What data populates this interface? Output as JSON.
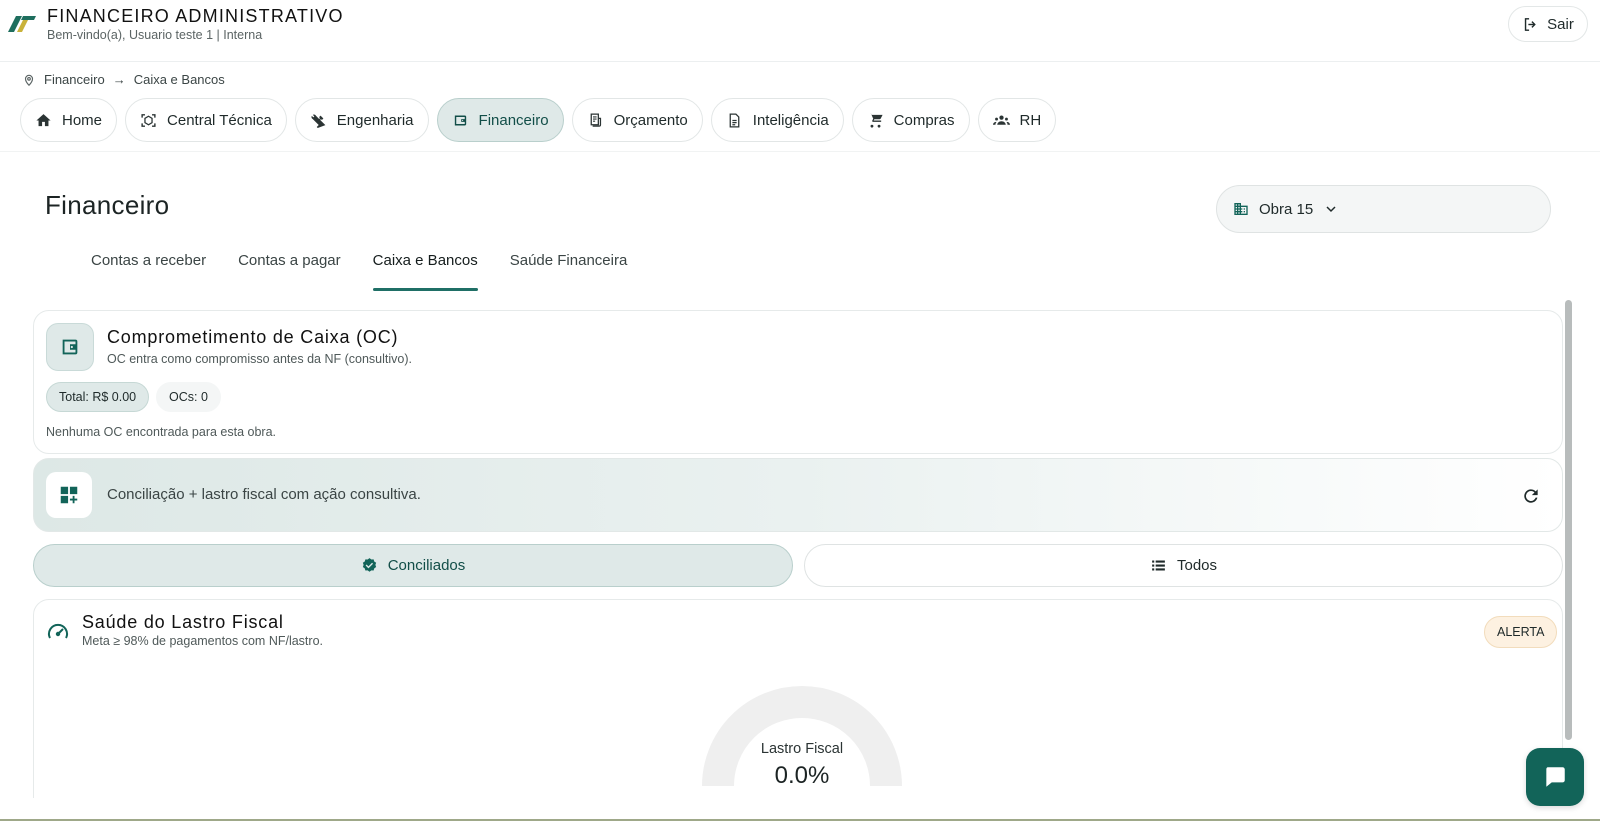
{
  "header": {
    "app_title": "FINANCEIRO ADMINISTRATIVO",
    "welcome": "Bem-vindo(a), Usuario teste 1 | Interna",
    "logout_label": "Sair"
  },
  "breadcrumb": {
    "items": [
      "Financeiro",
      "Caixa e Bancos"
    ],
    "separator": "→"
  },
  "modules": [
    {
      "label": "Home",
      "icon": "home-icon",
      "active": false
    },
    {
      "label": "Central Técnica",
      "icon": "scan-icon",
      "active": false
    },
    {
      "label": "Engenharia",
      "icon": "tools-icon",
      "active": false
    },
    {
      "label": "Financeiro",
      "icon": "wallet-icon",
      "active": true
    },
    {
      "label": "Orçamento",
      "icon": "receipt-icon",
      "active": false
    },
    {
      "label": "Inteligência",
      "icon": "document-icon",
      "active": false
    },
    {
      "label": "Compras",
      "icon": "cart-icon",
      "active": false
    },
    {
      "label": "RH",
      "icon": "people-icon",
      "active": false
    }
  ],
  "page": {
    "title": "Financeiro",
    "obra_selected": "Obra 15"
  },
  "subtabs": [
    {
      "label": "Contas a receber",
      "active": false
    },
    {
      "label": "Contas a pagar",
      "active": false
    },
    {
      "label": "Caixa e Bancos",
      "active": true
    },
    {
      "label": "Saúde Financeira",
      "active": false
    }
  ],
  "oc_card": {
    "title": "Comprometimento de Caixa (OC)",
    "subtitle": "OC entra como compromisso antes da NF (consultivo).",
    "total_chip": "Total: R$ 0.00",
    "ocs_chip": "OCs: 0",
    "empty_message": "Nenhuma OC encontrada para esta obra."
  },
  "conciliacao": {
    "text": "Conciliação + lastro fiscal com ação consultiva."
  },
  "segmented": {
    "conciliados_label": "Conciliados",
    "todos_label": "Todos",
    "selected": "Conciliados"
  },
  "saude_card": {
    "title": "Saúde do Lastro Fiscal",
    "subtitle": "Meta ≥ 98% de pagamentos com NF/lastro.",
    "badge": "ALERTA",
    "gauge_label": "Lastro Fiscal",
    "gauge_value": "0.0%",
    "gauge_fraction": 0.0
  },
  "colors": {
    "primary": "#126459",
    "primary_light": "#dfe9e8",
    "alert_bg": "#fdf1e1"
  }
}
